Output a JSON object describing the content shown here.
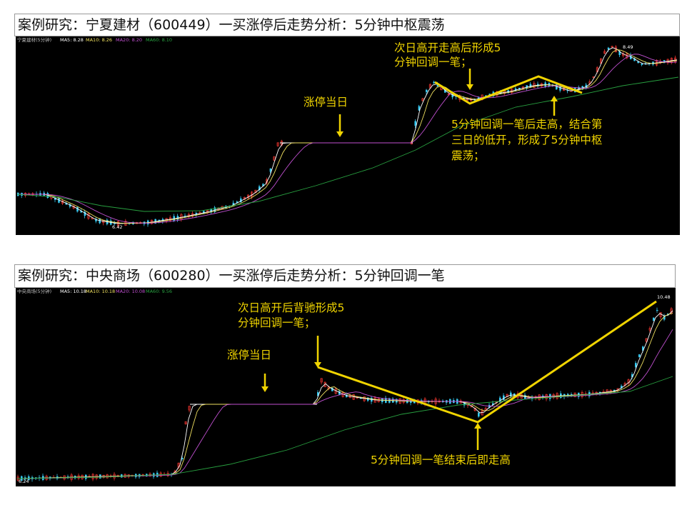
{
  "colors": {
    "background": "#000000",
    "up": "#e8342e",
    "down": "#36c8f0",
    "ma5": "#ffffff",
    "ma10": "#f0e060",
    "ma20": "#c050d0",
    "ma60": "#28a040",
    "annotation": "#f0d400"
  },
  "chart_data": [
    {
      "type": "candlestick",
      "title": "案例研究：宁夏建材（600449）一买涨停后走势分析：5分钟中枢震荡",
      "header": {
        "name": "宁夏建材(5分钟)",
        "ma5": "MA5: 8.28",
        "ma10": "MA10: 8.26",
        "ma20": "MA20: 8.20",
        "ma60": "MA60: 8.10"
      },
      "price_labels": {
        "high": "8.49",
        "low": "6.42"
      },
      "annotations": [
        "涨停当日",
        "次日高开走高后形成5",
        "分钟回调一笔；",
        "5分钟回调一笔后走高，结合第",
        "三日的低开，形成了5分钟中枢",
        "震荡；"
      ]
    },
    {
      "type": "candlestick",
      "title": "案例研究：中央商场（600280）一买涨停后走势分析：5分钟回调一笔",
      "header": {
        "name": "中央商场(5分钟)",
        "ma5": "MA5: 10.18",
        "ma10": "MA10: 10.18",
        "ma20": "MA20: 10.08",
        "ma60": "MA60: 9.56"
      },
      "price_labels": {
        "high": "10.48",
        "low": "6.24"
      },
      "annotations": [
        "涨停当日",
        "次日高开后背驰形成5",
        "分钟回调一笔；",
        "5分钟回调一笔结束后即走高"
      ]
    }
  ]
}
